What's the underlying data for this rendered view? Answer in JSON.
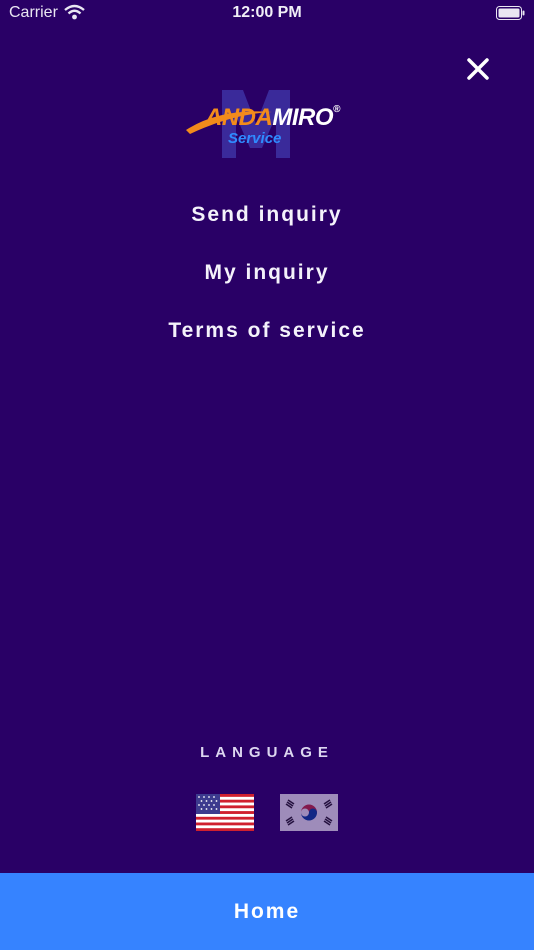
{
  "status_bar": {
    "carrier": "Carrier",
    "time": "12:00 PM",
    "icons": [
      "wifi-icon",
      "battery-icon"
    ]
  },
  "close_icon": "close-icon",
  "logo": {
    "brand_a": "ANDA",
    "brand_b": "MIRO",
    "trademark": "®",
    "service": "Service"
  },
  "menu": {
    "items": [
      {
        "label": "Send inquiry"
      },
      {
        "label": "My inquiry"
      },
      {
        "label": "Terms of service"
      }
    ]
  },
  "language": {
    "label": "LANGUAGE",
    "options": [
      {
        "icon": "us-flag-icon",
        "selected": true
      },
      {
        "icon": "korea-flag-icon",
        "selected": false
      }
    ]
  },
  "footer": {
    "home_label": "Home"
  },
  "colors": {
    "background": "#290066",
    "accent": "#3683ff",
    "logo_orange": "#f28b1b"
  }
}
